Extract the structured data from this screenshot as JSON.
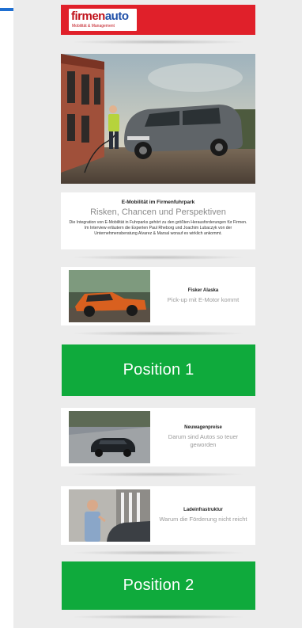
{
  "header": {
    "logo_main": "firmen",
    "logo_accent": "auto",
    "logo_sub": "Mobilität & Management"
  },
  "hero": {
    "image": "van-charging-photo"
  },
  "article": {
    "kicker": "E-Mobilität im Firmenfuhrpark",
    "headline": "Risken, Chancen und Perspektiven",
    "body": "Die Integration von E-Mobilität in Fuhrparks gehört zu den größten Herausforderungen für Firmen. Im Interview erläutern die Experten Paul Rheborg und Joachim Lubaczyk von der Unternehmensberatung Alvarez & Marsal worauf es wirklich ankommt."
  },
  "teasers": [
    {
      "title": "Fisker Alaska",
      "subtitle": "Pick-up mit E-Motor kommt",
      "image": "orange-pickup-photo"
    },
    {
      "title": "Neuwagenpreise",
      "subtitle": "Darum sind Autos so teuer geworden",
      "image": "dark-sedan-photo"
    },
    {
      "title": "Ladeinfrastruktur",
      "subtitle": "Warum die Förderung nicht reicht",
      "image": "charging-man-photo"
    }
  ],
  "ads": [
    {
      "label": "Position 1",
      "color": "#0faa3c"
    },
    {
      "label": "Position 2",
      "color": "#0faa3c"
    }
  ],
  "colors": {
    "brand_red": "#e0202a",
    "ad_green": "#0faa3c",
    "accent_blue": "#1f6fd1"
  }
}
